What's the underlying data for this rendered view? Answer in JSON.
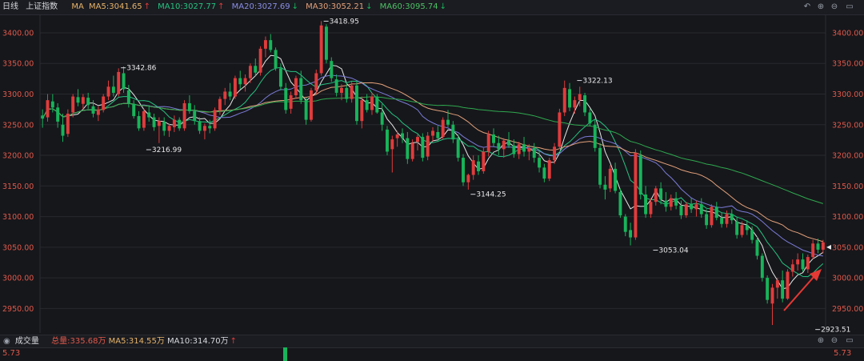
{
  "header": {
    "period": "日线",
    "index_name": "上证指数",
    "ma_label": "MA",
    "ma5": "MA5:3041.65",
    "ma10": "MA10:3027.77",
    "ma20": "MA20:3027.69",
    "ma30": "MA30:3052.21",
    "ma60": "MA60:3095.74",
    "ma5_arrow": "↑",
    "ma10_arrow": "↑",
    "ma20_arrow": "↓",
    "ma30_arrow": "↓",
    "ma60_arrow": "↓"
  },
  "controls": [
    "undo-icon",
    "zoom-in-icon",
    "zoom-out-icon",
    "collapse-icon"
  ],
  "volume_bar": {
    "title": "成交量",
    "total": "总量:335.68万",
    "ma5": "MA5:314.55万",
    "ma10": "MA10:314.70万",
    "ma10_arrow": "↑",
    "max_left": "5.73",
    "max_right": "5.73"
  },
  "colors": {
    "up": "#e03c3c",
    "down": "#18b45a",
    "ma5": "#e6e6e6",
    "ma10": "#26c281",
    "ma20": "#7b7bd8",
    "ma30": "#e2a07a",
    "ma60": "#2fa84f",
    "background": "#16171b",
    "annotation_arrow": "#e53935"
  },
  "chart_data": {
    "type": "candlestick",
    "ylim": [
      2910,
      3430
    ],
    "y_ticks": [
      "3400.00",
      "3350.00",
      "3300.00",
      "3250.00",
      "3200.00",
      "3150.00",
      "3100.00",
      "3050.00",
      "3000.00",
      "2950.00"
    ],
    "y_tick_values": [
      3400,
      3350,
      3300,
      3250,
      3200,
      3150,
      3100,
      3050,
      3000,
      2950
    ],
    "current_price_marker": 3050,
    "candles": [
      [
        3265,
        3275,
        3245,
        3260
      ],
      [
        3262,
        3300,
        3255,
        3290
      ],
      [
        3288,
        3300,
        3270,
        3278
      ],
      [
        3278,
        3285,
        3245,
        3255
      ],
      [
        3250,
        3268,
        3222,
        3232
      ],
      [
        3235,
        3275,
        3230,
        3268
      ],
      [
        3270,
        3300,
        3262,
        3296
      ],
      [
        3295,
        3308,
        3280,
        3286
      ],
      [
        3284,
        3300,
        3275,
        3295
      ],
      [
        3294,
        3302,
        3276,
        3282
      ],
      [
        3280,
        3290,
        3262,
        3268
      ],
      [
        3266,
        3280,
        3256,
        3275
      ],
      [
        3274,
        3300,
        3270,
        3296
      ],
      [
        3296,
        3322,
        3290,
        3312
      ],
      [
        3312,
        3330,
        3296,
        3302
      ],
      [
        3300,
        3342,
        3296,
        3336
      ],
      [
        3334,
        3345,
        3302,
        3308
      ],
      [
        3306,
        3315,
        3278,
        3285
      ],
      [
        3284,
        3290,
        3260,
        3264
      ],
      [
        3264,
        3272,
        3240,
        3244
      ],
      [
        3245,
        3276,
        3240,
        3272
      ],
      [
        3270,
        3282,
        3255,
        3262
      ],
      [
        3262,
        3268,
        3240,
        3246
      ],
      [
        3248,
        3262,
        3220,
        3256
      ],
      [
        3255,
        3262,
        3232,
        3240
      ],
      [
        3240,
        3252,
        3230,
        3248
      ],
      [
        3246,
        3265,
        3238,
        3258
      ],
      [
        3258,
        3262,
        3240,
        3244
      ],
      [
        3244,
        3290,
        3240,
        3285
      ],
      [
        3285,
        3298,
        3268,
        3272
      ],
      [
        3272,
        3282,
        3250,
        3256
      ],
      [
        3256,
        3262,
        3235,
        3240
      ],
      [
        3240,
        3252,
        3226,
        3248
      ],
      [
        3248,
        3258,
        3236,
        3244
      ],
      [
        3244,
        3278,
        3240,
        3274
      ],
      [
        3274,
        3296,
        3266,
        3292
      ],
      [
        3292,
        3310,
        3282,
        3304
      ],
      [
        3304,
        3318,
        3290,
        3296
      ],
      [
        3296,
        3330,
        3292,
        3326
      ],
      [
        3326,
        3338,
        3308,
        3316
      ],
      [
        3316,
        3332,
        3304,
        3326
      ],
      [
        3326,
        3350,
        3318,
        3346
      ],
      [
        3346,
        3358,
        3330,
        3335
      ],
      [
        3335,
        3378,
        3330,
        3374
      ],
      [
        3374,
        3394,
        3360,
        3388
      ],
      [
        3388,
        3398,
        3368,
        3372
      ],
      [
        3372,
        3376,
        3338,
        3342
      ],
      [
        3342,
        3350,
        3306,
        3312
      ],
      [
        3310,
        3318,
        3268,
        3274
      ],
      [
        3276,
        3304,
        3268,
        3298
      ],
      [
        3298,
        3330,
        3292,
        3326
      ],
      [
        3326,
        3338,
        3284,
        3290
      ],
      [
        3290,
        3294,
        3250,
        3258
      ],
      [
        3258,
        3310,
        3255,
        3306
      ],
      [
        3306,
        3340,
        3300,
        3334
      ],
      [
        3334,
        3419,
        3330,
        3412
      ],
      [
        3410,
        3414,
        3350,
        3356
      ],
      [
        3354,
        3360,
        3320,
        3326
      ],
      [
        3324,
        3332,
        3296,
        3302
      ],
      [
        3302,
        3316,
        3290,
        3310
      ],
      [
        3310,
        3318,
        3286,
        3292
      ],
      [
        3292,
        3320,
        3286,
        3314
      ],
      [
        3314,
        3322,
        3250,
        3256
      ],
      [
        3256,
        3296,
        3244,
        3290
      ],
      [
        3290,
        3300,
        3270,
        3274
      ],
      [
        3274,
        3302,
        3266,
        3296
      ],
      [
        3296,
        3300,
        3268,
        3270
      ],
      [
        3270,
        3284,
        3240,
        3250
      ],
      [
        3242,
        3248,
        3200,
        3206
      ],
      [
        3210,
        3232,
        3172,
        3226
      ],
      [
        3228,
        3240,
        3214,
        3234
      ],
      [
        3236,
        3244,
        3220,
        3228
      ],
      [
        3228,
        3238,
        3186,
        3194
      ],
      [
        3194,
        3226,
        3190,
        3220
      ],
      [
        3222,
        3234,
        3208,
        3230
      ],
      [
        3230,
        3236,
        3190,
        3196
      ],
      [
        3198,
        3238,
        3192,
        3232
      ],
      [
        3232,
        3246,
        3222,
        3240
      ],
      [
        3238,
        3248,
        3222,
        3228
      ],
      [
        3230,
        3262,
        3226,
        3258
      ],
      [
        3258,
        3274,
        3246,
        3250
      ],
      [
        3250,
        3256,
        3220,
        3226
      ],
      [
        3226,
        3234,
        3190,
        3196
      ],
      [
        3196,
        3202,
        3150,
        3156
      ],
      [
        3156,
        3170,
        3144,
        3168
      ],
      [
        3168,
        3200,
        3160,
        3192
      ],
      [
        3190,
        3200,
        3168,
        3174
      ],
      [
        3174,
        3212,
        3170,
        3206
      ],
      [
        3206,
        3240,
        3198,
        3234
      ],
      [
        3234,
        3244,
        3214,
        3220
      ],
      [
        3220,
        3232,
        3200,
        3210
      ],
      [
        3210,
        3228,
        3196,
        3224
      ],
      [
        3224,
        3238,
        3212,
        3216
      ],
      [
        3216,
        3226,
        3196,
        3202
      ],
      [
        3202,
        3222,
        3194,
        3218
      ],
      [
        3218,
        3230,
        3198,
        3206
      ],
      [
        3206,
        3218,
        3192,
        3212
      ],
      [
        3212,
        3220,
        3188,
        3196
      ],
      [
        3196,
        3208,
        3172,
        3180
      ],
      [
        3180,
        3186,
        3156,
        3162
      ],
      [
        3162,
        3196,
        3158,
        3192
      ],
      [
        3192,
        3220,
        3186,
        3214
      ],
      [
        3214,
        3276,
        3210,
        3270
      ],
      [
        3270,
        3322,
        3264,
        3310
      ],
      [
        3308,
        3318,
        3272,
        3278
      ],
      [
        3278,
        3296,
        3268,
        3290
      ],
      [
        3290,
        3312,
        3280,
        3300
      ],
      [
        3298,
        3302,
        3264,
        3270
      ],
      [
        3270,
        3276,
        3248,
        3252
      ],
      [
        3250,
        3258,
        3206,
        3212
      ],
      [
        3212,
        3220,
        3146,
        3152
      ],
      [
        3152,
        3166,
        3128,
        3144
      ],
      [
        3146,
        3184,
        3140,
        3178
      ],
      [
        3178,
        3188,
        3138,
        3142
      ],
      [
        3140,
        3146,
        3098,
        3102
      ],
      [
        3100,
        3104,
        3068,
        3075
      ],
      [
        3078,
        3090,
        3053,
        3066
      ],
      [
        3066,
        3210,
        3062,
        3204
      ],
      [
        3200,
        3208,
        3128,
        3136
      ],
      [
        3136,
        3150,
        3098,
        3104
      ],
      [
        3104,
        3130,
        3098,
        3124
      ],
      [
        3124,
        3150,
        3118,
        3146
      ],
      [
        3146,
        3156,
        3120,
        3128
      ],
      [
        3126,
        3140,
        3108,
        3116
      ],
      [
        3116,
        3136,
        3110,
        3130
      ],
      [
        3130,
        3140,
        3112,
        3118
      ],
      [
        3118,
        3126,
        3096,
        3102
      ],
      [
        3102,
        3124,
        3098,
        3120
      ],
      [
        3120,
        3130,
        3106,
        3112
      ],
      [
        3112,
        3126,
        3100,
        3120
      ],
      [
        3120,
        3130,
        3098,
        3104
      ],
      [
        3104,
        3112,
        3080,
        3086
      ],
      [
        3086,
        3120,
        3082,
        3116
      ],
      [
        3116,
        3124,
        3094,
        3098
      ],
      [
        3098,
        3106,
        3082,
        3088
      ],
      [
        3088,
        3110,
        3082,
        3104
      ],
      [
        3104,
        3112,
        3088,
        3094
      ],
      [
        3092,
        3100,
        3064,
        3070
      ],
      [
        3070,
        3092,
        3066,
        3086
      ],
      [
        3086,
        3094,
        3070,
        3078
      ],
      [
        3078,
        3084,
        3056,
        3062
      ],
      [
        3062,
        3068,
        3030,
        3036
      ],
      [
        3036,
        3040,
        2994,
        3000
      ],
      [
        3000,
        3004,
        2958,
        2964
      ],
      [
        2958,
        2990,
        2923,
        2984
      ],
      [
        2984,
        3000,
        2966,
        2996
      ],
      [
        2996,
        3012,
        2960,
        2966
      ],
      [
        2966,
        3014,
        2964,
        3010
      ],
      [
        3010,
        3030,
        3002,
        3022
      ],
      [
        3022,
        3040,
        3012,
        3030
      ],
      [
        3030,
        3040,
        3010,
        3014
      ],
      [
        3014,
        3038,
        3008,
        3034
      ],
      [
        3034,
        3062,
        3030,
        3056
      ],
      [
        3056,
        3064,
        3040,
        3046
      ],
      [
        3046,
        3062,
        3040,
        3058
      ]
    ],
    "annotations": [
      {
        "label": "3342.86",
        "index": 15,
        "value": 3342.86,
        "side": "right",
        "anchor": "high"
      },
      {
        "label": "3216.99",
        "index": 20,
        "value": 3216.99,
        "side": "right",
        "anchor": "low"
      },
      {
        "label": "3418.95",
        "index": 55,
        "value": 3418.95,
        "side": "right",
        "anchor": "high"
      },
      {
        "label": "3144.25",
        "index": 84,
        "value": 3144.25,
        "side": "right",
        "anchor": "low"
      },
      {
        "label": "3322.13",
        "index": 105,
        "value": 3322.13,
        "side": "right",
        "anchor": "high"
      },
      {
        "label": "3053.04",
        "index": 120,
        "value": 3053.04,
        "side": "right",
        "anchor": "low"
      },
      {
        "label": "2923.51",
        "index": 152,
        "value": 2923.51,
        "side": "right",
        "anchor": "low"
      }
    ],
    "moving_averages": [
      {
        "key": "ma5",
        "period": 5
      },
      {
        "key": "ma10",
        "period": 10
      },
      {
        "key": "ma20",
        "period": 20
      },
      {
        "key": "ma30",
        "period": 30
      },
      {
        "key": "ma60",
        "period": 60
      }
    ],
    "volume_first_bar": {
      "index": 55,
      "max": 5.73
    }
  }
}
